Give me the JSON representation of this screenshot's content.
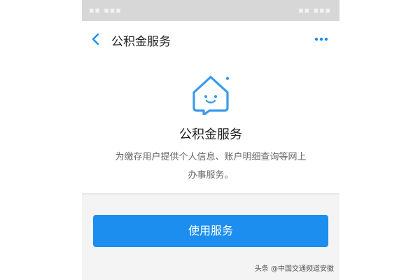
{
  "nav": {
    "title": "公积金服务",
    "back_icon": "chevron-left-icon",
    "more_icon": "more-dots-icon"
  },
  "service": {
    "icon": "house-smile-icon",
    "title": "公积金服务",
    "description": "为缴存用户提供个人信息、账户明细查询等网上办事服务。"
  },
  "footer": {
    "button_label": "使用服务"
  },
  "watermark": {
    "text": "头条 @中国交通频道安徽"
  },
  "colors": {
    "accent": "#1c8ef0",
    "icon_blue": "#3a9bea",
    "status_bar": "#d7d7d7",
    "footer_bg": "#f4f4f4"
  }
}
